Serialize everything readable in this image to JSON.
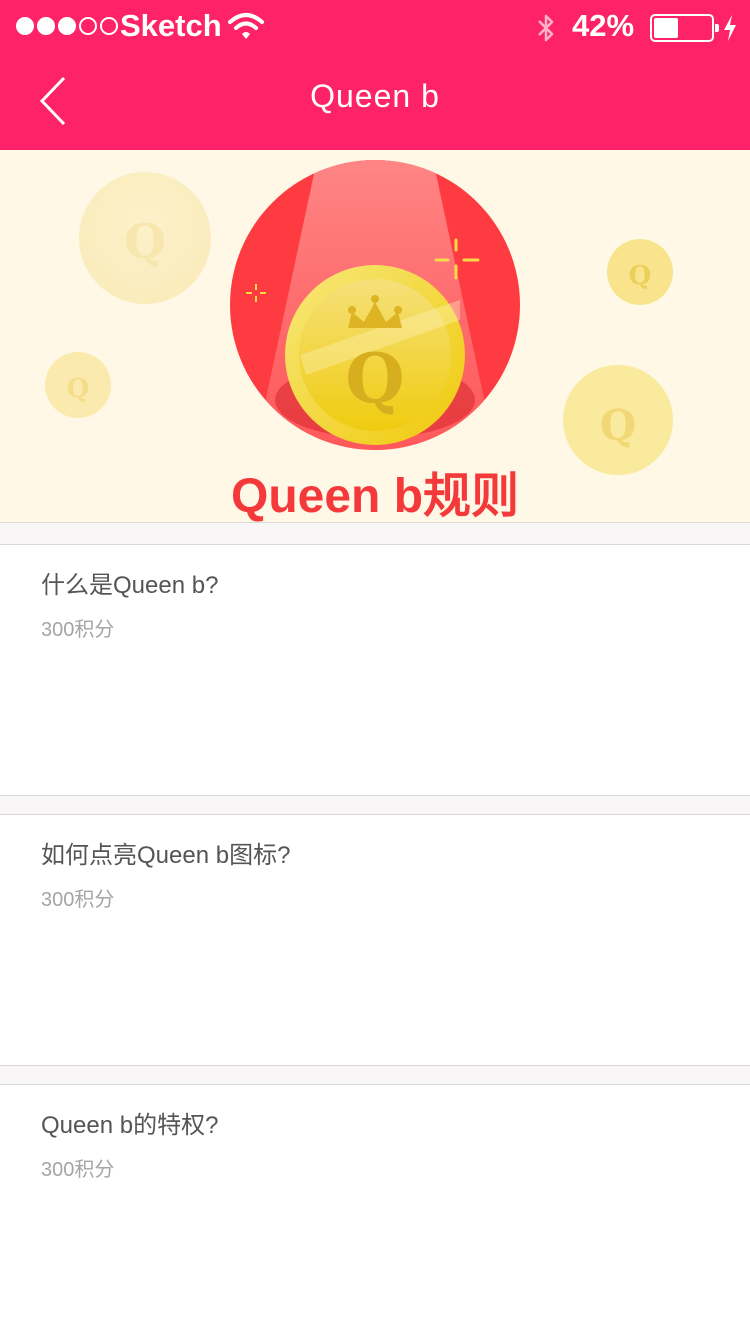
{
  "status_bar": {
    "carrier": "Sketch",
    "battery_percent": "42%",
    "battery_level": 0.42
  },
  "nav": {
    "title": "Queen b"
  },
  "banner": {
    "title": "Queen b规则"
  },
  "rules": [
    {
      "question": "什么是Queen b?",
      "points": "300积分"
    },
    {
      "question": "如何点亮Queen b图标?",
      "points": "300积分"
    },
    {
      "question": "Queen b的特权?",
      "points": "300积分"
    }
  ],
  "colors": {
    "brand": "#fe2369",
    "banner_bg": "#fff8e6",
    "banner_title": "#f4393b",
    "coin_gold": "#f2cf1a"
  }
}
